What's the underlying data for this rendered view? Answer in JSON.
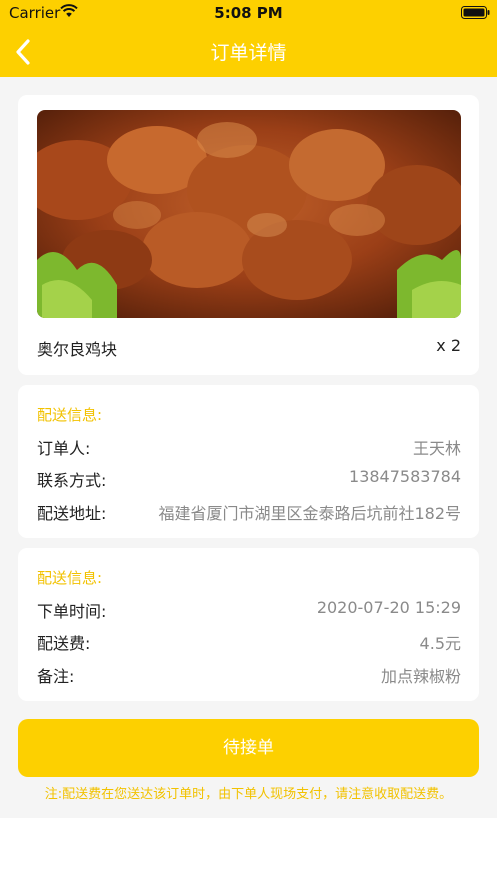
{
  "status_bar": {
    "carrier": "Carrier",
    "time": "5:08 PM"
  },
  "nav": {
    "title": "订单详情"
  },
  "product": {
    "name": "奥尔良鸡块",
    "quantity": "x 2"
  },
  "delivery_info": {
    "title": "配送信息:",
    "orderer_label": "订单人:",
    "orderer_value": "王天林",
    "contact_label": "联系方式:",
    "contact_value": "13847583784",
    "address_label": "配送地址:",
    "address_value": "福建省厦门市湖里区金泰路后坑前社182号"
  },
  "order_info": {
    "title": "配送信息:",
    "time_label": "下单时间:",
    "time_value": "2020-07-20 15:29",
    "fee_label": "配送费:",
    "fee_value": "4.5元",
    "remark_label": "备注:",
    "remark_value": "加点辣椒粉"
  },
  "action": {
    "button_label": "待接单"
  },
  "footer_note": "注:配送费在您送达该订单时，由下单人现场支付，请注意收取配送费。",
  "colors": {
    "accent": "#FDD000",
    "accent_text": "#F2C200",
    "background": "#F5F5F5"
  }
}
